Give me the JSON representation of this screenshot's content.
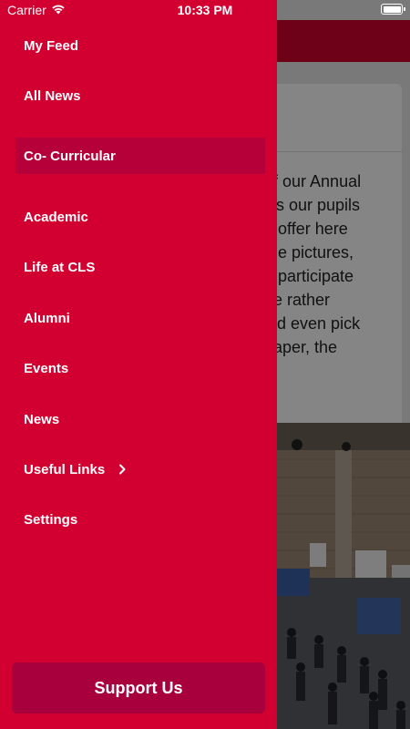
{
  "status_bar": {
    "carrier": "Carrier",
    "time": "10:33 PM",
    "wifi_icon": "wifi-icon",
    "battery_icon": "battery-icon"
  },
  "drawer": {
    "items": [
      {
        "label": "My Feed"
      },
      {
        "label": "All News"
      },
      {
        "label": "Co- Curricular",
        "active": true
      },
      {
        "label": "Academic"
      },
      {
        "label": "Life at CLS"
      },
      {
        "label": "Alumni"
      },
      {
        "label": "Events"
      },
      {
        "label": "News"
      },
      {
        "label": "Useful Links",
        "has_submenu": true,
        "icon": "chevron-right-icon"
      },
      {
        "label": "Settings"
      }
    ],
    "support_label": "Support Us",
    "colors": {
      "background": "#d10030",
      "active": "#b5003a",
      "button": "#a8003d"
    }
  },
  "background_article": {
    "lines": [
      "of our Annual",
      "ws our pupils",
      "n offer here",
      "the pictures,",
      "o participate",
      "he rather",
      "uld even pick",
      "paper, the"
    ]
  }
}
